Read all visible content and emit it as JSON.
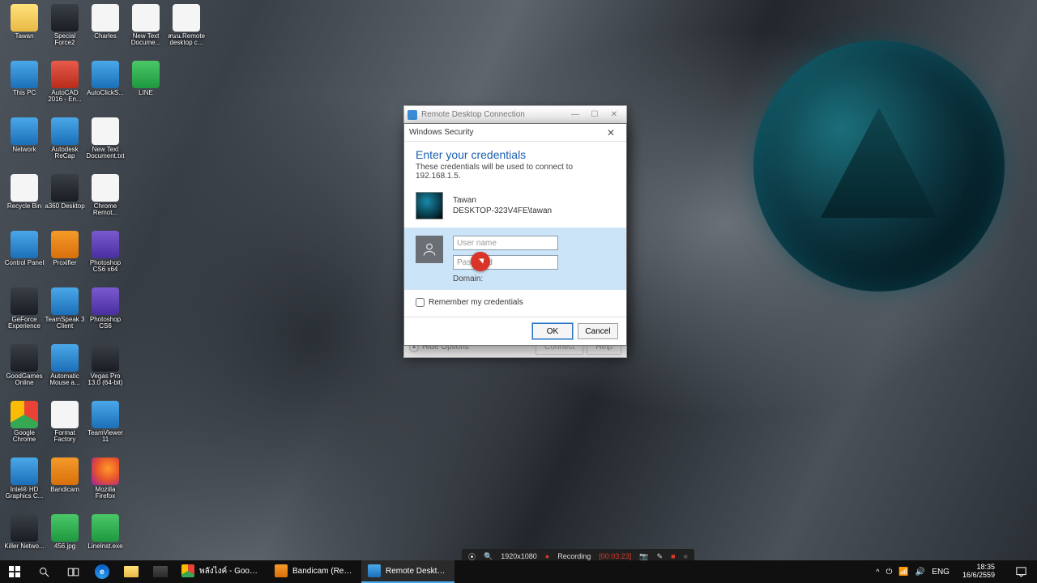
{
  "desktop_icons": [
    {
      "label": "Tawan",
      "cls": "ic-folder"
    },
    {
      "label": "Special Force2",
      "cls": "ic-dark"
    },
    {
      "label": "Charles",
      "cls": "ic-white"
    },
    {
      "label": "New Text Docume...",
      "cls": "ic-white"
    },
    {
      "label": "สนน.Remote desktop c...",
      "cls": "ic-white"
    },
    {
      "label": "",
      "cls": ""
    },
    {
      "label": "This PC",
      "cls": "ic-blue"
    },
    {
      "label": "AutoCAD 2016 - En...",
      "cls": "ic-red"
    },
    {
      "label": "AutoClickS...",
      "cls": "ic-blue"
    },
    {
      "label": "LINE",
      "cls": "ic-green"
    },
    {
      "label": "",
      "cls": ""
    },
    {
      "label": "",
      "cls": ""
    },
    {
      "label": "Network",
      "cls": "ic-blue"
    },
    {
      "label": "Autodesk ReCap",
      "cls": "ic-blue"
    },
    {
      "label": "New Text Document.txt",
      "cls": "ic-white"
    },
    {
      "label": "",
      "cls": ""
    },
    {
      "label": "",
      "cls": ""
    },
    {
      "label": "",
      "cls": ""
    },
    {
      "label": "Recycle Bin",
      "cls": "ic-white"
    },
    {
      "label": "a360 Desktop",
      "cls": "ic-dark"
    },
    {
      "label": "Chrome Remot...",
      "cls": "ic-white"
    },
    {
      "label": "",
      "cls": ""
    },
    {
      "label": "",
      "cls": ""
    },
    {
      "label": "",
      "cls": ""
    },
    {
      "label": "Control Panel",
      "cls": "ic-blue"
    },
    {
      "label": "Proxifier",
      "cls": "ic-orange"
    },
    {
      "label": "Photoshop CS6 x64",
      "cls": "ic-purple"
    },
    {
      "label": "",
      "cls": ""
    },
    {
      "label": "",
      "cls": ""
    },
    {
      "label": "",
      "cls": ""
    },
    {
      "label": "GeForce Experience",
      "cls": "ic-dark"
    },
    {
      "label": "TeamSpeak 3 Client",
      "cls": "ic-blue"
    },
    {
      "label": "Photoshop CS6",
      "cls": "ic-purple"
    },
    {
      "label": "",
      "cls": ""
    },
    {
      "label": "",
      "cls": ""
    },
    {
      "label": "",
      "cls": ""
    },
    {
      "label": "GoodGames Online",
      "cls": "ic-dark"
    },
    {
      "label": "Automatic Mouse a...",
      "cls": "ic-blue"
    },
    {
      "label": "Vegas Pro 13.0 (64-bit)",
      "cls": "ic-dark"
    },
    {
      "label": "",
      "cls": ""
    },
    {
      "label": "",
      "cls": ""
    },
    {
      "label": "",
      "cls": ""
    },
    {
      "label": "Google Chrome",
      "cls": "ic-chrome"
    },
    {
      "label": "Format Factory",
      "cls": "ic-white"
    },
    {
      "label": "TeamViewer 11",
      "cls": "ic-blue"
    },
    {
      "label": "",
      "cls": ""
    },
    {
      "label": "",
      "cls": ""
    },
    {
      "label": "",
      "cls": ""
    },
    {
      "label": "Intel® HD Graphics C...",
      "cls": "ic-blue"
    },
    {
      "label": "Bandicam",
      "cls": "ic-orange"
    },
    {
      "label": "Mozilla Firefox",
      "cls": "ic-firefox"
    },
    {
      "label": "",
      "cls": ""
    },
    {
      "label": "",
      "cls": ""
    },
    {
      "label": "",
      "cls": ""
    },
    {
      "label": "Killer Netwo...",
      "cls": "ic-dark"
    },
    {
      "label": "456.jpg",
      "cls": "ic-green"
    },
    {
      "label": "LineInst.exe",
      "cls": "ic-green"
    }
  ],
  "bandicam": {
    "res": "1920x1080",
    "label": "Recording",
    "time": "[00:03:23]"
  },
  "rdc": {
    "title": "Remote Desktop Connection",
    "hide_options": "Hide Options",
    "connect": "Connect",
    "help": "Help"
  },
  "sec": {
    "title": "Windows Security",
    "heading": "Enter your credentials",
    "sub": "These credentials will be used to connect to 192.168.1.5.",
    "user": "Tawan",
    "machine": "DESKTOP-323V4FE\\tawan",
    "ph_user": "User name",
    "ph_pass": "Password",
    "domain": "Domain:",
    "remember": "Remember my credentials",
    "ok": "OK",
    "cancel": "Cancel"
  },
  "taskbar": {
    "apps": [
      {
        "label": "พลังไงค์ - Google C...",
        "cls": "ic-chrome"
      },
      {
        "label": "Bandicam (Register...",
        "cls": "ic-orange"
      },
      {
        "label": "Remote Desktop C...",
        "cls": "ic-blue"
      }
    ],
    "lang": "ENG",
    "time": "18:35",
    "date": "16/6/2559"
  }
}
